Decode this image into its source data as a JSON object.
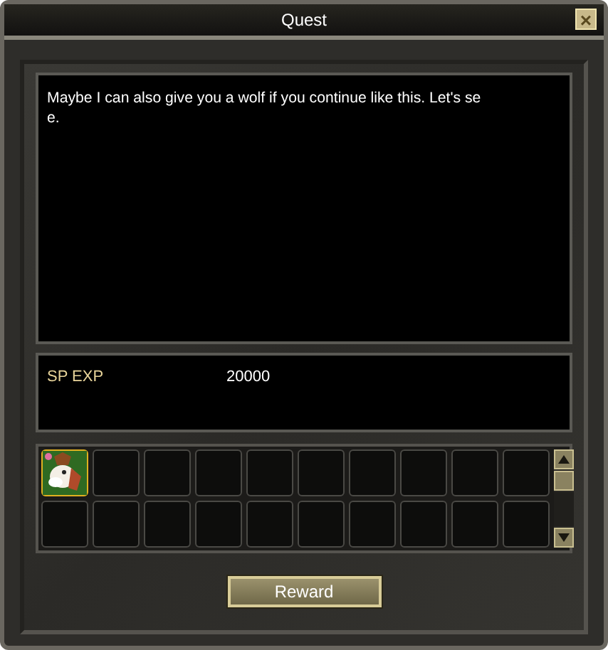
{
  "window": {
    "title": "Quest",
    "close": "×"
  },
  "dialogue": {
    "lines": [
      "Maybe I can also give you a wolf if you continue like this. Let's se",
      "e."
    ]
  },
  "rewards": [
    {
      "label": "SP EXP",
      "value": "20000"
    }
  ],
  "slots": [
    {
      "filled": true
    },
    {
      "filled": false
    },
    {
      "filled": false
    },
    {
      "filled": false
    },
    {
      "filled": false
    },
    {
      "filled": false
    },
    {
      "filled": false
    },
    {
      "filled": false
    },
    {
      "filled": false
    },
    {
      "filled": false
    },
    {
      "filled": false
    },
    {
      "filled": false
    },
    {
      "filled": false
    },
    {
      "filled": false
    },
    {
      "filled": false
    },
    {
      "filled": false
    },
    {
      "filled": false
    },
    {
      "filled": false
    },
    {
      "filled": false
    },
    {
      "filled": false
    }
  ],
  "button": "Reward"
}
